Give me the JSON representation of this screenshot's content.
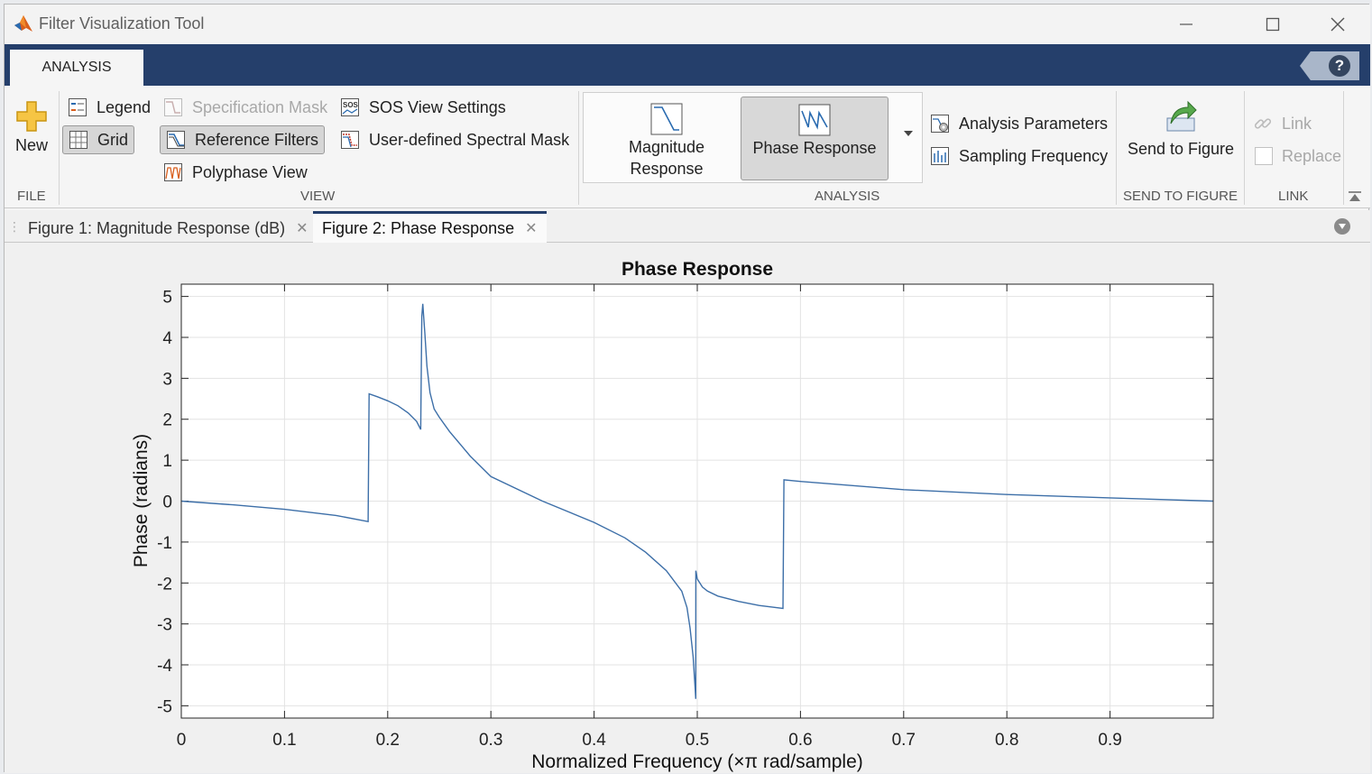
{
  "window": {
    "title": "Filter Visualization Tool"
  },
  "ribbon": {
    "tab": "ANALYSIS",
    "help_label": "?",
    "file": {
      "new_label": "New",
      "section": "FILE"
    },
    "view": {
      "legend": "Legend",
      "grid": "Grid",
      "spec_mask": "Specification Mask",
      "reference_filters": "Reference Filters",
      "polyphase_view": "Polyphase View",
      "sos_view": "SOS View Settings",
      "user_mask": "User-defined Spectral Mask",
      "section": "VIEW"
    },
    "analysis": {
      "magnitude_line1": "Magnitude",
      "magnitude_line2": "Response",
      "phase": "Phase Response",
      "parameters": "Analysis Parameters",
      "sampling": "Sampling Frequency",
      "section": "ANALYSIS"
    },
    "send": {
      "label": "Send to Figure",
      "section": "SEND TO FIGURE"
    },
    "link": {
      "link": "Link",
      "replace": "Replace",
      "section": "LINK"
    }
  },
  "doc_tabs": [
    {
      "label": "Figure 1: Magnitude Response (dB)",
      "active": false
    },
    {
      "label": "Figure 2: Phase Response",
      "active": true
    }
  ],
  "chart_data": {
    "type": "line",
    "title": "Phase Response",
    "xlabel": "Normalized  Frequency  (×π rad/sample)",
    "ylabel": "Phase (radians)",
    "xlim": [
      0,
      1
    ],
    "ylim": [
      -5.3,
      5.3
    ],
    "xticks": [
      "0",
      "0.1",
      "0.2",
      "0.3",
      "0.4",
      "0.5",
      "0.6",
      "0.7",
      "0.8",
      "0.9"
    ],
    "yticks": [
      "5",
      "4",
      "3",
      "2",
      "1",
      "0",
      "-1",
      "-2",
      "-3",
      "-4",
      "-5"
    ],
    "grid": true,
    "line_color": "#3d6fa8",
    "series": [
      {
        "x": [
          0,
          0.05,
          0.1,
          0.15,
          0.181,
          0.182,
          0.19,
          0.2,
          0.21,
          0.22,
          0.228,
          0.232,
          0.233,
          0.234,
          0.236,
          0.238,
          0.241,
          0.245,
          0.25,
          0.26,
          0.28,
          0.3,
          0.35,
          0.4,
          0.43,
          0.45,
          0.47,
          0.485,
          0.49,
          0.493,
          0.496,
          0.498,
          0.4985,
          0.4986,
          0.5,
          0.505,
          0.51,
          0.52,
          0.54,
          0.56,
          0.583,
          0.584,
          0.6,
          0.7,
          0.8,
          0.9,
          1.0
        ],
        "y": [
          0,
          -0.09,
          -0.2,
          -0.35,
          -0.5,
          2.62,
          2.55,
          2.45,
          2.33,
          2.15,
          1.95,
          1.75,
          4.5,
          4.82,
          4.1,
          3.3,
          2.65,
          2.25,
          2.05,
          1.7,
          1.1,
          0.6,
          0.0,
          -0.52,
          -0.9,
          -1.25,
          -1.7,
          -2.2,
          -2.6,
          -3.1,
          -3.8,
          -4.6,
          -4.83,
          -1.7,
          -1.9,
          -2.1,
          -2.2,
          -2.32,
          -2.45,
          -2.55,
          -2.62,
          0.52,
          0.48,
          0.28,
          0.16,
          0.08,
          0.0
        ]
      }
    ]
  }
}
